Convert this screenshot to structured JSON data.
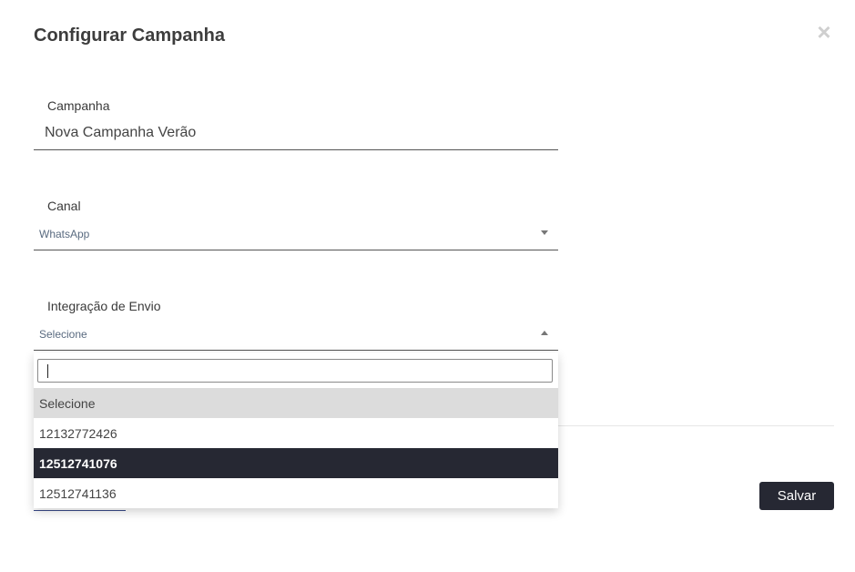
{
  "modal": {
    "title": "Configurar Campanha",
    "close_glyph": "×"
  },
  "campaign": {
    "label": "Campanha",
    "value": "Nova Campanha Verão"
  },
  "channel": {
    "label": "Canal",
    "value": "WhatsApp"
  },
  "integration": {
    "label": "Integração de Envio",
    "value": "Selecione",
    "search_value": "",
    "options": [
      {
        "label": "Selecione",
        "state": "selected"
      },
      {
        "label": "12132772426",
        "state": "normal"
      },
      {
        "label": "12512741076",
        "state": "highlighted"
      },
      {
        "label": "12512741136",
        "state": "normal"
      }
    ]
  },
  "footer": {
    "save_label": "Salvar"
  },
  "colors": {
    "primary_dark": "#262833",
    "selected_option": "#dcdcdc",
    "select_text": "#5a6b80"
  },
  "icons": {
    "close": "close-icon",
    "channel_caret": "chevron-down-icon",
    "integration_caret": "chevron-up-icon"
  }
}
